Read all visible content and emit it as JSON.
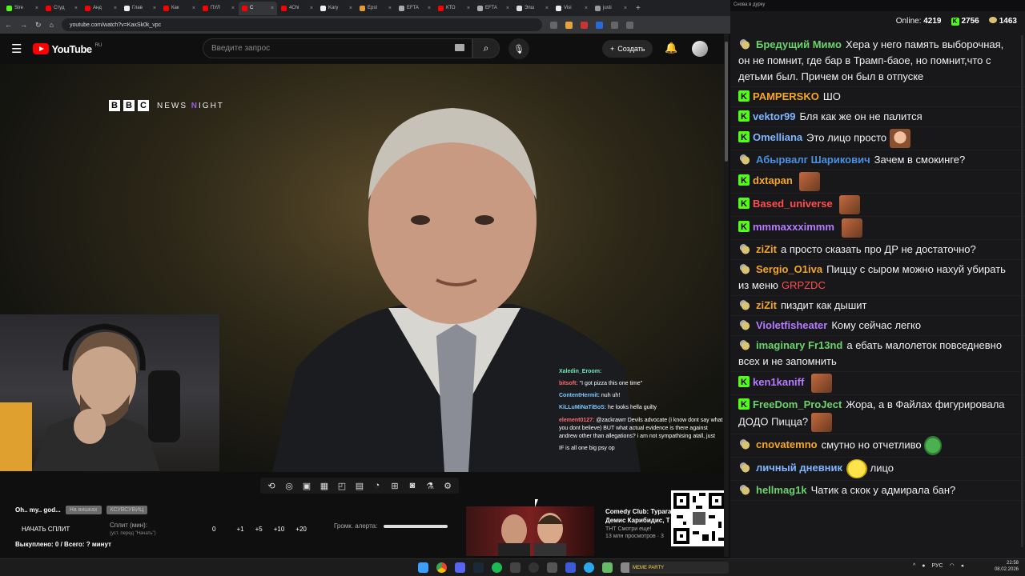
{
  "browser": {
    "tabs": [
      {
        "label": "Stre",
        "color": "#53fc18"
      },
      {
        "label": "Студ",
        "color": "#ff0000"
      },
      {
        "label": "Анд",
        "color": "#ff0000"
      },
      {
        "label": "Глав",
        "color": "#eeeeee"
      },
      {
        "label": "Как",
        "color": "#ff0000"
      },
      {
        "label": "ПУЛ",
        "color": "#ff0000"
      },
      {
        "label": "С",
        "color": "#ff0000",
        "active": true
      },
      {
        "label": "4Chi",
        "color": "#ff0000"
      },
      {
        "label": "Kary",
        "color": "#eeeeee"
      },
      {
        "label": "Epst",
        "color": "#e89a2c"
      },
      {
        "label": "EFTA",
        "color": "#aaaaaa"
      },
      {
        "label": "КТО",
        "color": "#ff0000"
      },
      {
        "label": "EFTA",
        "color": "#aaaaaa"
      },
      {
        "label": "Эпш",
        "color": "#dddddd"
      },
      {
        "label": "Visi",
        "color": "#eeeeee"
      },
      {
        "label": "justi",
        "color": "#999999"
      }
    ],
    "url": "youtube.com/watch?v=KaxSk0k_vpc"
  },
  "youtube": {
    "logo_text": "YouTube",
    "region": "RU",
    "search_placeholder": "Введите запрос",
    "create_label": "Создать"
  },
  "video": {
    "bbc_letters": [
      "B",
      "B",
      "C"
    ],
    "bbc_show": "NEWS",
    "bbc_n": "N",
    "bbc_show2": "IGHT",
    "overlay_chat": [
      {
        "user": "Xaledin_Eroom:",
        "text": "",
        "color": "#6ee7b7"
      },
      {
        "user": "bitsoft:",
        "text": "\"I got pizza this one time\"",
        "color": "#ff6b6b"
      },
      {
        "user": "ContentHermit:",
        "text": "nuh uh!",
        "color": "#7cc7ff"
      },
      {
        "user": "KiLLuMiNaTiBoS:",
        "text": "he looks hella guilty",
        "color": "#7cc7ff"
      },
      {
        "user": "element0127:",
        "text": "@zackrawrr Devils advocate (i know dont say what you dont believe) BUT what actual evidence is there against andrew other than allegations? i am not sympathising atall, just",
        "color": "#ff6b6b"
      },
      {
        "user": "",
        "text": "IF is all one big psy op",
        "color": "#ffffff"
      }
    ]
  },
  "stream_panel": {
    "title": "Oh.. my.. god...",
    "chip1": "На вишках",
    "chip2": "КСУВСУВИЦ",
    "split_button": "НАЧАТЬ СПЛИТ",
    "split_label": "Сплит (мин):",
    "split_sub": "(уст. перед \"Начать\")",
    "split_value": "0",
    "increments": [
      "+1",
      "+5",
      "+10",
      "+20"
    ],
    "volume_label": "Громк. алерта:",
    "volume_level": 1.0,
    "bought_text": "Выкуплено: 0 / Всего: ? минут"
  },
  "recommendation": {
    "title1": "Comedy Club: Турага",
    "title2": "Демис Карибидис, Т",
    "channel": "ТНТ Смотри еще!",
    "views": "13 млн просмотров · 3"
  },
  "chat": {
    "window_title": "Снова в дурку",
    "online_label": "Online:",
    "online_count": "4219",
    "stat1": "2756",
    "stat2": "1463",
    "messages": [
      {
        "badge": "p",
        "user": "Бредущий Мимо",
        "color": "#6bd36b",
        "text": "Хера у него память выборочная, он не помнит, где бар в Трамп-баое, но помнит,что с детьми был. Причем он был в отпуске",
        "emote": ""
      },
      {
        "badge": "k",
        "user": "PAMPERSKO",
        "color": "#f5a623",
        "text": "ШО",
        "emote": ""
      },
      {
        "badge": "k",
        "user": "vektor99",
        "color": "#7fb6ff",
        "text": "Бля как же он не палится",
        "emote": ""
      },
      {
        "badge": "k",
        "user": "Omelliana",
        "color": "#7fb6ff",
        "text": "Это лицо просто",
        "emote": "face"
      },
      {
        "badge": "p",
        "user": "Абырвалг Шарикович",
        "color": "#4a90e2",
        "text": "Зачем в смокинге?",
        "emote": ""
      },
      {
        "badge": "k",
        "user": "dxtapan",
        "color": "#f5a623",
        "text": "",
        "emote": "brown"
      },
      {
        "badge": "k",
        "user": "Based_universe",
        "color": "#ff4d4d",
        "text": "",
        "emote": "brown"
      },
      {
        "badge": "k",
        "user": "mmmaxxximmm",
        "color": "#b57cff",
        "text": "",
        "emote": "brown"
      },
      {
        "badge": "p",
        "user": "ziZit",
        "color": "#f5a623",
        "text": "а просто сказать про ДР не достаточно?",
        "emote": ""
      },
      {
        "badge": "p",
        "user": "Sergio_O1iva",
        "color": "#f5a623",
        "text": "Пиццу с сыром можно нахуй убирать из меню",
        "extra": "GRPZDC",
        "emote": ""
      },
      {
        "badge": "p",
        "user": "ziZit",
        "color": "#f5a623",
        "text": "пиздит как дышит",
        "emote": ""
      },
      {
        "badge": "p",
        "user": "Violetfisheater",
        "color": "#b57cff",
        "text": "Кому сейчас легко",
        "emote": ""
      },
      {
        "badge": "p",
        "user": "imaginary Fr13nd",
        "color": "#6bd36b",
        "text": "а ебать малолеток повседневно всех и не запомнить",
        "emote": ""
      },
      {
        "badge": "k",
        "user": "ken1kaniff",
        "color": "#b57cff",
        "text": "",
        "emote": "brown"
      },
      {
        "badge": "k",
        "user": "FreeDom_ProJect",
        "color": "#6bd36b",
        "text": "Жора, а в Файлах фигурировала ДОДО Пицца?",
        "emote": "brown"
      },
      {
        "badge": "p",
        "user": "cnovatemno",
        "color": "#f5a623",
        "text": "смутно но отчетливо",
        "emote": "pepe"
      },
      {
        "badge": "p",
        "user": "личный дневник",
        "color": "#7fb6ff",
        "text": "лицо",
        "emote": "yellow",
        "emote_first": true
      },
      {
        "badge": "p",
        "user": "hellmag1k",
        "color": "#6bd36b",
        "text": "Чатик а скок у адмирала бан?",
        "emote": ""
      }
    ]
  },
  "taskbar": {
    "widget_text": "MEME PARTY",
    "lang": "РУС",
    "time": "22:58",
    "date": "08.02.2026"
  }
}
